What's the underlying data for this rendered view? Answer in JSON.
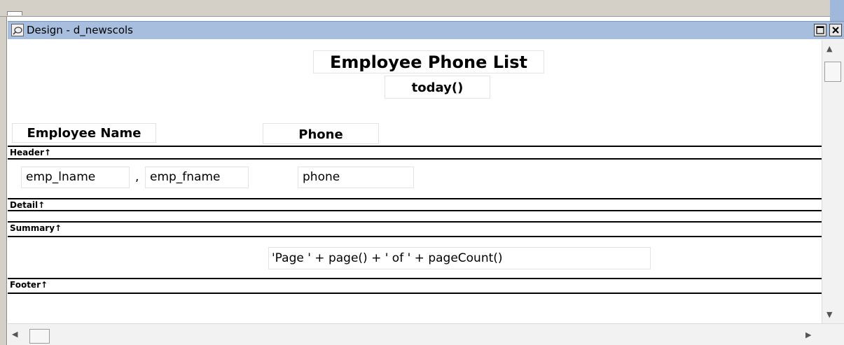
{
  "window": {
    "title": "Design - d_newscols",
    "maximize_symbol": "□",
    "close_symbol": "✕",
    "icon": "datawindow-design-icon"
  },
  "report": {
    "title": "Employee Phone List",
    "date_expr": "today()",
    "columns": {
      "name_header": "Employee Name",
      "phone_header": "Phone"
    },
    "detail": {
      "lname": "emp_lname",
      "separator": ",",
      "fname": "emp_fname",
      "phone": "phone"
    },
    "footer_expr": "'Page ' + page() + ' of ' + pageCount()"
  },
  "bands": {
    "header": "Header↑",
    "detail": "Detail↑",
    "summary": "Summary↑",
    "footer": "Footer↑"
  },
  "scrollbars": {
    "up": "▲",
    "down": "▼",
    "left": "◀",
    "right": "▶"
  },
  "colors": {
    "titlebar": "#a7bedf",
    "frame": "#d4d0c8"
  }
}
